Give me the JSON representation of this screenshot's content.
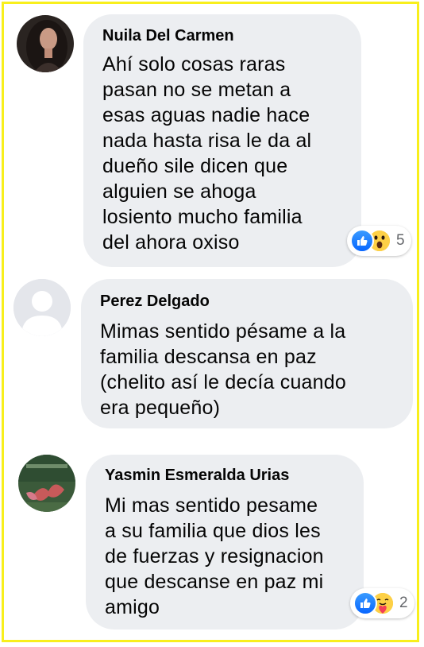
{
  "comments": [
    {
      "author": "Nuila Del Carmen",
      "avatar_icon": "user-photo-woman",
      "text": "Ahí solo cosas raras\npasan no se metan a\nesas aguas nadie hace\nnada hasta risa le da al\ndueño sile dicen que\nalguien se ahoga\nlosiento mucho familia\ndel ahora oxiso",
      "reactions": {
        "icons": [
          "like-icon",
          "wow-icon"
        ],
        "count": "5"
      }
    },
    {
      "author": "Perez Delgado",
      "avatar_icon": "default-user-icon",
      "text": "Mimas sentido pésame a la\nfamilia descansa en paz\n(chelito así le decía cuando\nera pequeño)"
    },
    {
      "author": "Yasmin Esmeralda Urias",
      "avatar_icon": "user-photo-butterfly",
      "text": "Mi mas sentido pesame\na su familia que dios les\nde fuerzas y resignacion\nque descanse en paz mi\namigo",
      "reactions": {
        "icons": [
          "like-icon",
          "care-icon"
        ],
        "count": "2"
      }
    }
  ],
  "colors": {
    "frame": "#f8ef1c",
    "bubble": "#eceef1",
    "like": "#0866ff",
    "reaction_yellow": "#fdd046",
    "count": "#65676b"
  }
}
